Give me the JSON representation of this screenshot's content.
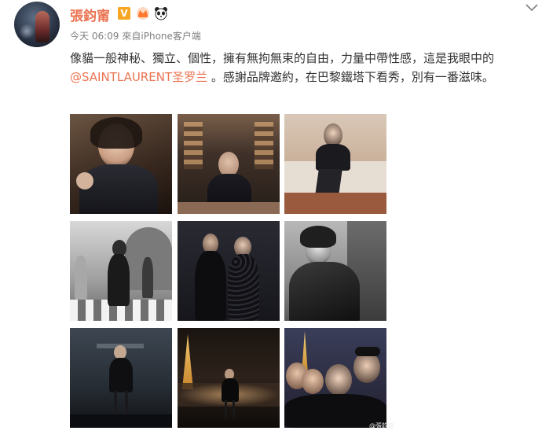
{
  "post": {
    "username": "張鈞甯",
    "verified_badge": "V",
    "member_icon": "crown-icon",
    "panda_icon": "panda-icon",
    "time": "今天 06:09",
    "source": "來自iPhone客户端",
    "text_part1": "像貓一般神秘、獨立、個性，擁有無拘無束的自由，力量中帶性感，這是我眼中的",
    "mention": "@SAINTLAURENT圣罗兰",
    "text_part2": " 。感謝品牌邀約，在巴黎鐵塔下看秀，別有一番滋味。",
    "more_icon": "chevron-down-icon"
  },
  "photos": [
    {
      "name": "photo-1",
      "desc": "portrait-warm"
    },
    {
      "name": "photo-2",
      "desc": "city-night-velvet"
    },
    {
      "name": "photo-3",
      "desc": "sofa-pose"
    },
    {
      "name": "photo-4",
      "desc": "street-bw"
    },
    {
      "name": "photo-5",
      "desc": "event-duo"
    },
    {
      "name": "photo-6",
      "desc": "portrait-bw"
    },
    {
      "name": "photo-7",
      "desc": "stage-backdrop"
    },
    {
      "name": "photo-8",
      "desc": "eiffel-night"
    },
    {
      "name": "photo-9",
      "desc": "group-selfie"
    }
  ],
  "watermark": "@張鈞甯"
}
